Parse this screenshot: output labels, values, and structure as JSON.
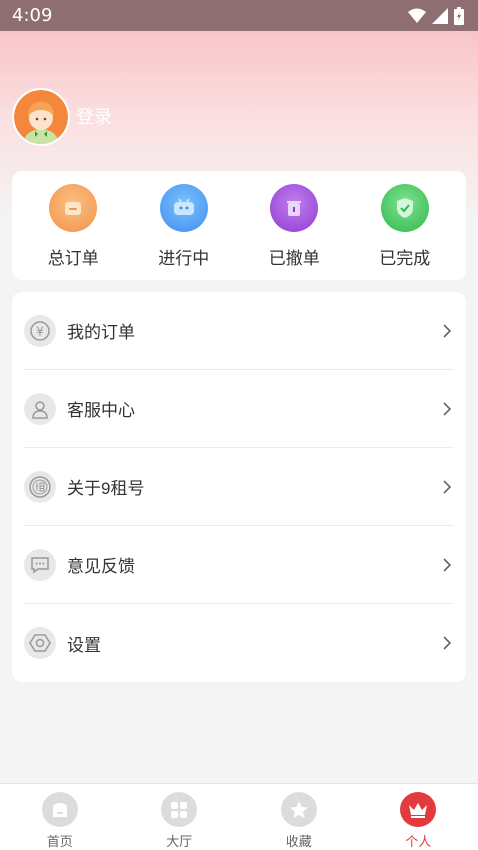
{
  "status": {
    "time": "4:09"
  },
  "profile": {
    "login_label": "登录"
  },
  "orders": [
    {
      "label": "总订单",
      "icon": "list-icon",
      "color": "#f4a35e"
    },
    {
      "label": "进行中",
      "icon": "in-progress-icon",
      "color": "#4a9ff3"
    },
    {
      "label": "已撤单",
      "icon": "trash-icon",
      "color": "#9f4ad8"
    },
    {
      "label": "已完成",
      "icon": "shield-check-icon",
      "color": "#3cc45a"
    }
  ],
  "menu": [
    {
      "label": "我的订单",
      "icon": "yen-icon"
    },
    {
      "label": "客服中心",
      "icon": "user-icon"
    },
    {
      "label": "关于9租号",
      "icon": "zu-badge-icon"
    },
    {
      "label": "意见反馈",
      "icon": "feedback-icon"
    },
    {
      "label": "设置",
      "icon": "settings-icon"
    }
  ],
  "tabs": [
    {
      "label": "首页",
      "icon": "home-icon"
    },
    {
      "label": "大厅",
      "icon": "grid-icon"
    },
    {
      "label": "收藏",
      "icon": "star-icon"
    },
    {
      "label": "个人",
      "icon": "crown-icon",
      "active": true
    }
  ],
  "colors": {
    "accent": "#e23a3d",
    "status_bar": "#8f6e72"
  }
}
